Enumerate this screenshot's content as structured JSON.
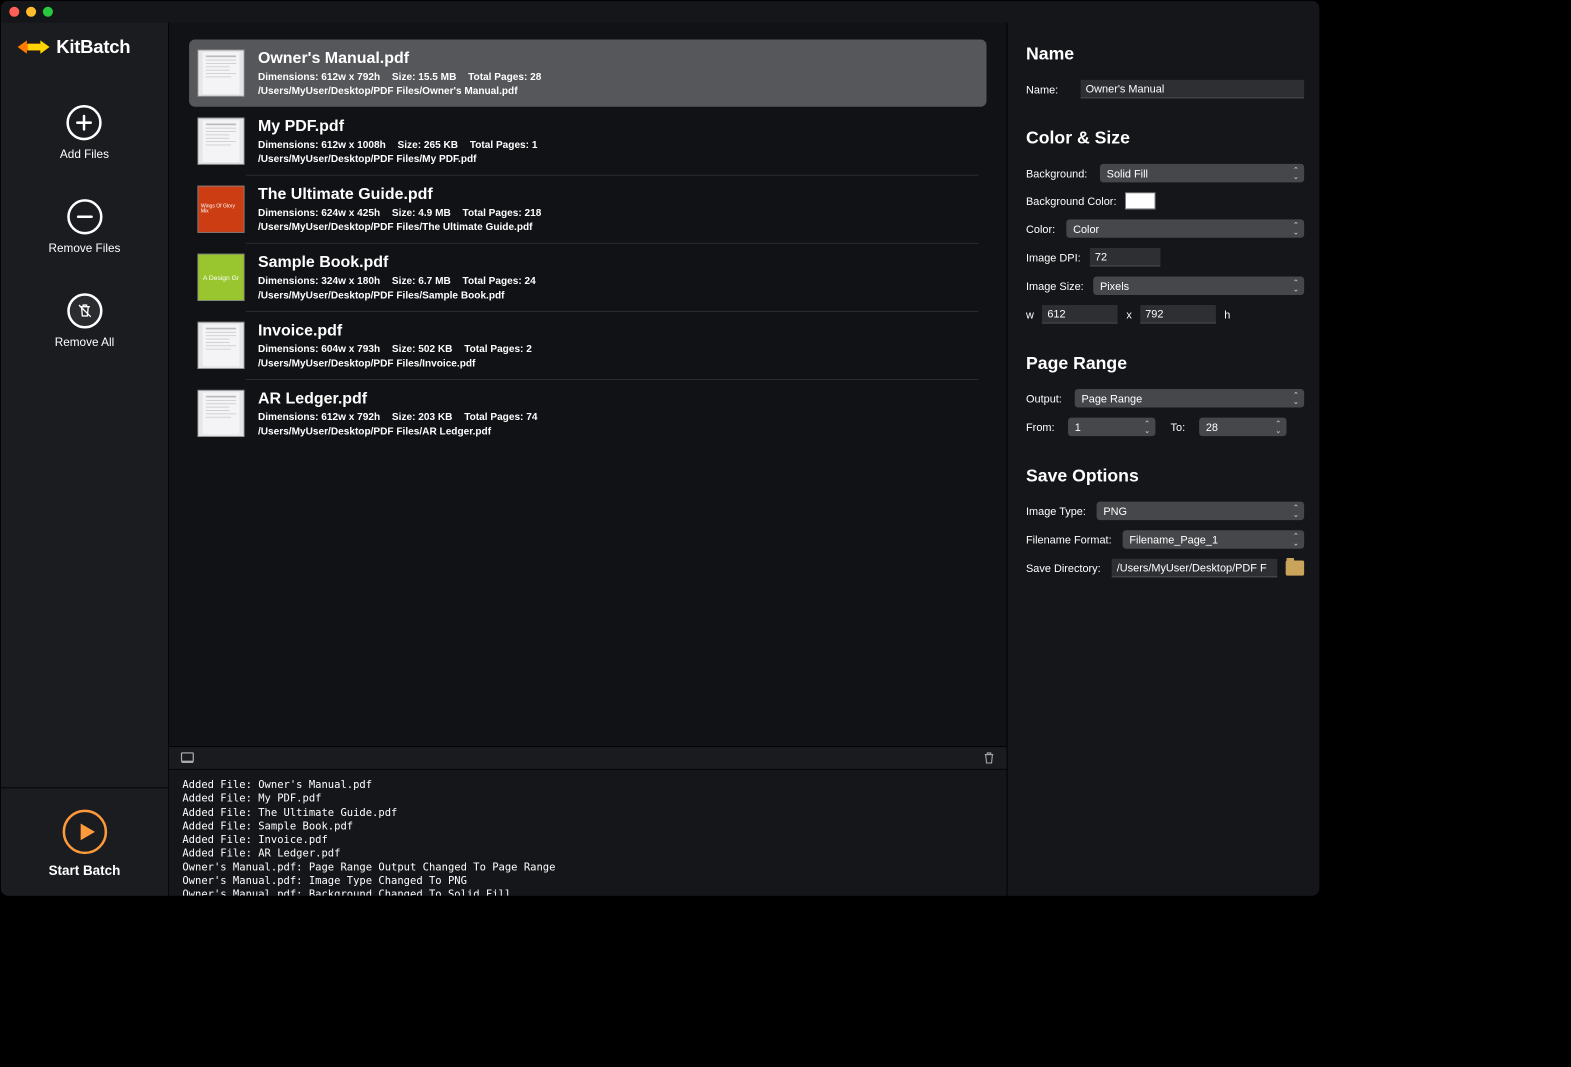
{
  "app": {
    "name": "KitBatch"
  },
  "sidebar": {
    "add_files": "Add Files",
    "remove_files": "Remove Files",
    "remove_all": "Remove All",
    "start_batch": "Start Batch"
  },
  "files": [
    {
      "name": "Owner's Manual.pdf",
      "dims": "Dimensions: 612w x 792h",
      "size": "Size: 15.5 MB",
      "pages": "Total Pages: 28",
      "path": "/Users/MyUser/Desktop/PDF Files/Owner's Manual.pdf",
      "selected": true,
      "thumb": "doc"
    },
    {
      "name": "My PDF.pdf",
      "dims": "Dimensions: 612w x 1008h",
      "size": "Size: 265 KB",
      "pages": "Total Pages: 1",
      "path": "/Users/MyUser/Desktop/PDF Files/My PDF.pdf",
      "selected": false,
      "thumb": "table"
    },
    {
      "name": "The Ultimate Guide.pdf",
      "dims": "Dimensions: 624w x 425h",
      "size": "Size: 4.9 MB",
      "pages": "Total Pages: 218",
      "path": "/Users/MyUser/Desktop/PDF Files/The Ultimate Guide.pdf",
      "selected": false,
      "thumb": "orange"
    },
    {
      "name": "Sample Book.pdf",
      "dims": "Dimensions: 324w x 180h",
      "size": "Size: 6.7 MB",
      "pages": "Total Pages: 24",
      "path": "/Users/MyUser/Desktop/PDF Files/Sample Book.pdf",
      "selected": false,
      "thumb": "green"
    },
    {
      "name": "Invoice.pdf",
      "dims": "Dimensions: 604w x 793h",
      "size": "Size: 502 KB",
      "pages": "Total Pages: 2",
      "path": "/Users/MyUser/Desktop/PDF Files/Invoice.pdf",
      "selected": false,
      "thumb": "invoice"
    },
    {
      "name": "AR Ledger.pdf",
      "dims": "Dimensions: 612w x 792h",
      "size": "Size: 203 KB",
      "pages": "Total Pages: 74",
      "path": "/Users/MyUser/Desktop/PDF Files/AR Ledger.pdf",
      "selected": false,
      "thumb": "ledger"
    }
  ],
  "log_lines": [
    "Added File: Owner's Manual.pdf",
    "Added File: My PDF.pdf",
    "Added File: The Ultimate Guide.pdf",
    "Added File: Sample Book.pdf",
    "Added File: Invoice.pdf",
    "Added File: AR Ledger.pdf",
    "Owner's Manual.pdf: Page Range Output Changed To Page Range",
    "Owner's Manual.pdf: Image Type Changed To PNG",
    "Owner's Manual.pdf: Background Changed To Solid Fill"
  ],
  "panel": {
    "name_section": {
      "title": "Name",
      "name_label": "Name:",
      "name_value": "Owner's Manual"
    },
    "color_section": {
      "title": "Color & Size",
      "background_label": "Background:",
      "background_value": "Solid Fill",
      "bgcolor_label": "Background Color:",
      "color_label": "Color:",
      "color_value": "Color",
      "dpi_label": "Image DPI:",
      "dpi_value": "72",
      "size_label": "Image Size:",
      "size_value": "Pixels",
      "w_label": "w",
      "w_value": "612",
      "x_label": "x",
      "h_label": "h",
      "h_value": "792"
    },
    "range_section": {
      "title": "Page Range",
      "output_label": "Output:",
      "output_value": "Page Range",
      "from_label": "From:",
      "from_value": "1",
      "to_label": "To:",
      "to_value": "28"
    },
    "save_section": {
      "title": "Save Options",
      "type_label": "Image Type:",
      "type_value": "PNG",
      "format_label": "Filename Format:",
      "format_value": "Filename_Page_1",
      "dir_label": "Save Directory:",
      "dir_value": "/Users/MyUser/Desktop/PDF F"
    }
  }
}
